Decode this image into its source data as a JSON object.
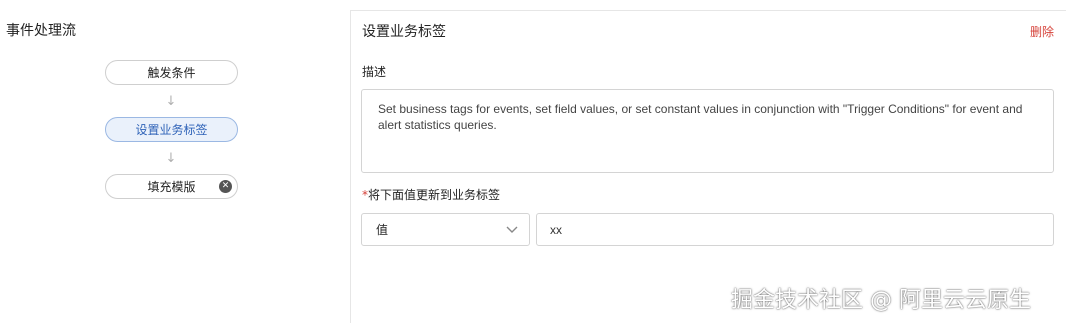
{
  "left_panel": {
    "title": "事件处理流",
    "nodes": [
      {
        "label": "触发条件"
      },
      {
        "label": "设置业务标签"
      },
      {
        "label": "填充模版"
      }
    ],
    "arrow_glyph": "↓"
  },
  "right_panel": {
    "title": "设置业务标签",
    "delete_label": "删除",
    "description_label": "描述",
    "description_text": "Set business tags for events, set field values, or set constant values in conjunction with \"Trigger Conditions\" for event and alert statistics queries.",
    "update_label": "将下面值更新到业务标签",
    "required_mark": "*",
    "select_value": "值",
    "input_value": "xx"
  },
  "watermark": "掘金技术社区 @ 阿里云云原生",
  "colors": {
    "accent_blue": "#2f63b8",
    "active_bg": "#eaf1fb",
    "danger": "#d6423a"
  }
}
